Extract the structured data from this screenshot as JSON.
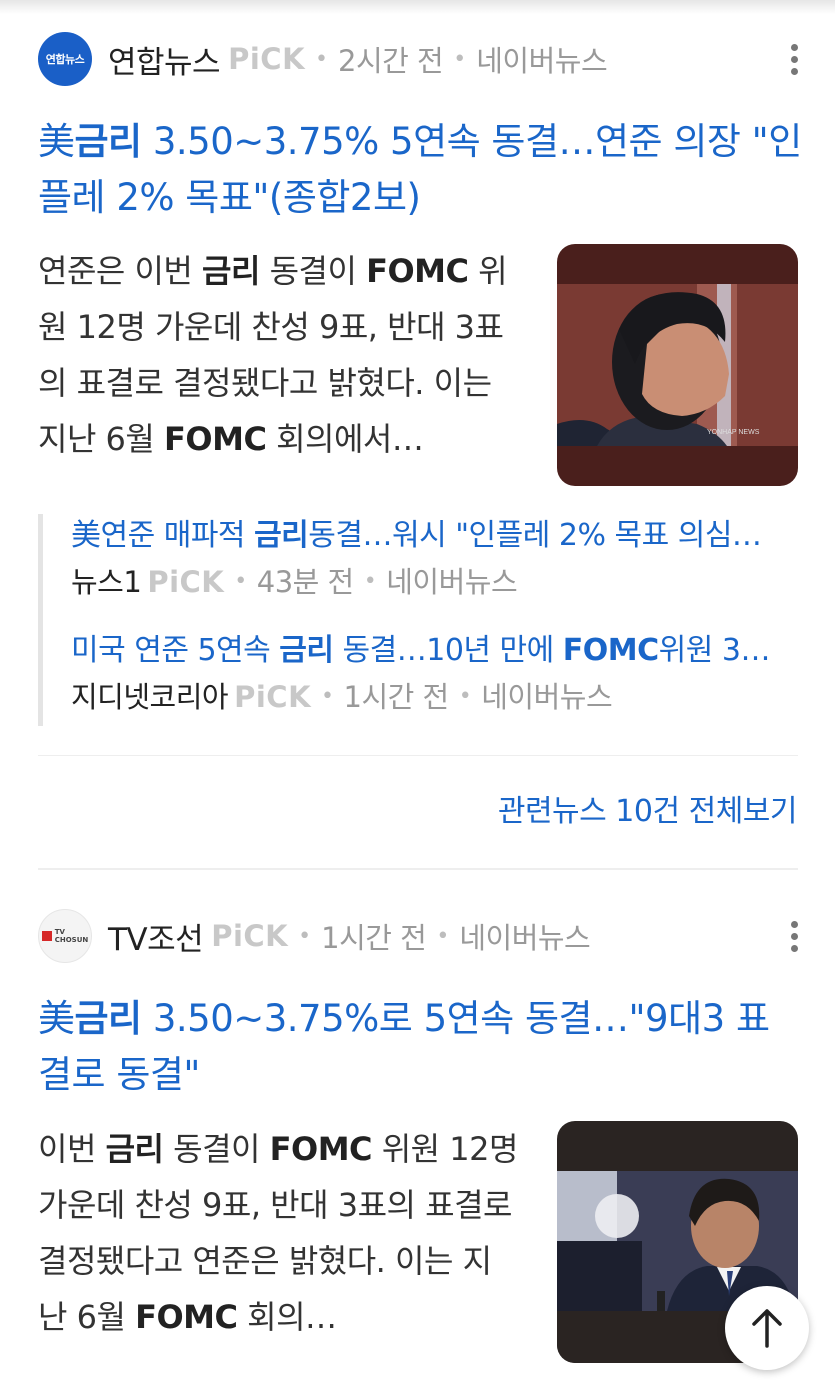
{
  "articles": [
    {
      "source": {
        "name": "연합뉴스",
        "logo_text": "연합뉴스",
        "pick": "PiCK",
        "time": "2시간 전",
        "platform": "네이버뉴스"
      },
      "headline": {
        "prefix": "美",
        "highlight": "금리",
        "rest": " 3.50~3.75% 5연속 동결…연준 의장 \"인플레 2% 목표\"(종합2보)"
      },
      "snippet": {
        "t1": "연준은 이번 ",
        "k1": "금리",
        "t2": " 동결이 ",
        "k2": "FOMC",
        "t3": " 위원 12명 가운데 찬성 9표, 반대 3표의 표결로 결정됐다고 밝혔다. 이는 지난 6월 ",
        "k3": "FOMC",
        "t4": " 회의에서…"
      },
      "thumb_watermark": "YONHAP NEWS",
      "related": [
        {
          "title": {
            "t1": "美연준 매파적 ",
            "k1": "금리",
            "t2": "동결…워시 \"인플레 2% 목표 의심…"
          },
          "source": "뉴스1",
          "pick": "PiCK",
          "time": "43분 전",
          "platform": "네이버뉴스"
        },
        {
          "title": {
            "t1": "미국 연준 5연속 ",
            "k1": "금리",
            "t2": " 동결…10년 만에 ",
            "k2": "FOMC",
            "t3": "위원 3…"
          },
          "source": "지디넷코리아",
          "pick": "PiCK",
          "time": "1시간 전",
          "platform": "네이버뉴스"
        }
      ],
      "see_all": "관련뉴스 10건 전체보기"
    },
    {
      "source": {
        "name": "TV조선",
        "logo_text_top": "TV",
        "logo_text_bottom": "CHOSUN",
        "pick": "PiCK",
        "time": "1시간 전",
        "platform": "네이버뉴스"
      },
      "headline": {
        "prefix": "美",
        "highlight": "금리",
        "rest": " 3.50~3.75%로 5연속 동결…\"9대3 표결로 동결\""
      },
      "snippet": {
        "t1": "이번 ",
        "k1": "금리",
        "t2": " 동결이 ",
        "k2": "FOMC",
        "t3": " 위원 12명 가운데 찬성 9표, 반대 3표의 표결로 결정됐다고 연준은 밝혔다. 이는 지난 6월 ",
        "k3": "FOMC",
        "t4": " 회의…"
      }
    }
  ],
  "icons": {
    "more": "more-vertical-icon",
    "scroll_top": "arrow-up-icon"
  }
}
